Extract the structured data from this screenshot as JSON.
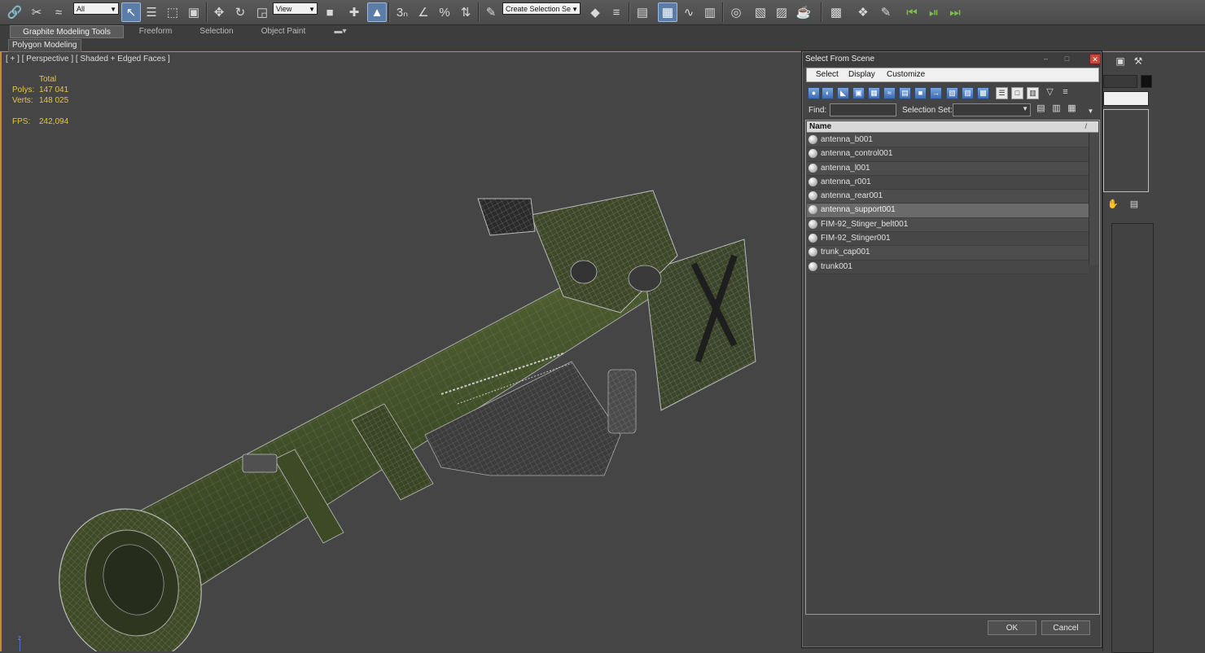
{
  "toolbar": {
    "selection_filter": "All",
    "reference_coord": "View",
    "named_selection_placeholder": "Create Selection Se",
    "icons": [
      "link-icon",
      "unlink-icon",
      "bind-space-warp-icon",
      "select-object-icon",
      "select-by-name-icon",
      "rect-region-icon",
      "window-crossing-icon",
      "move-icon",
      "rotate-icon",
      "scale-icon",
      "snap-toggle-icon",
      "angle-snap-icon",
      "percent-snap-icon",
      "spinner-snap-icon",
      "edit-named-selection-icon",
      "mirror-icon",
      "align-icon",
      "layer-manager-icon",
      "graphite-toggle-icon",
      "curve-editor-icon",
      "schematic-view-icon",
      "material-editor-icon",
      "render-setup-icon",
      "rendered-frame-icon",
      "render-icon"
    ]
  },
  "ribbon": {
    "tabs": [
      {
        "label": "Graphite Modeling Tools",
        "active": true
      },
      {
        "label": "Freeform",
        "active": false
      },
      {
        "label": "Selection",
        "active": false
      },
      {
        "label": "Object Paint",
        "active": false
      }
    ],
    "panel_label": "Polygon Modeling"
  },
  "viewport": {
    "label": "[ + ] [ Perspective ] [ Shaded + Edged Faces ]",
    "stats": {
      "total_label": "Total",
      "polys_label": "Polys:",
      "polys_value": "147 041",
      "verts_label": "Verts:",
      "verts_value": "148 025",
      "fps_label": "FPS:",
      "fps_value": "242,094"
    },
    "axis_label": "z"
  },
  "dialog": {
    "title": "Select From Scene",
    "menu": [
      "Select",
      "Display",
      "Customize"
    ],
    "find_label": "Find:",
    "find_value": "",
    "selection_set_label": "Selection Set:",
    "selection_set_value": "",
    "column_header": "Name",
    "items": [
      {
        "name": "antenna_b001",
        "selected": false
      },
      {
        "name": "antenna_control001",
        "selected": false
      },
      {
        "name": "antenna_l001",
        "selected": false
      },
      {
        "name": "antenna_r001",
        "selected": false
      },
      {
        "name": "antenna_rear001",
        "selected": false
      },
      {
        "name": "antenna_support001",
        "selected": true
      },
      {
        "name": "FIM-92_Stinger_belt001",
        "selected": false
      },
      {
        "name": "FIM-92_Stinger001",
        "selected": false
      },
      {
        "name": "trunk_cap001",
        "selected": false
      },
      {
        "name": "trunk001",
        "selected": false
      }
    ],
    "ok_label": "OK",
    "cancel_label": "Cancel"
  },
  "colors": {
    "viewport_bg": "#454545",
    "stats_text": "#e5c54a",
    "model_green": "#4a5a2c",
    "wire": "#b7b7b7",
    "accent_orange": "#c98a2b",
    "selection_blue": "#5c7da8"
  }
}
